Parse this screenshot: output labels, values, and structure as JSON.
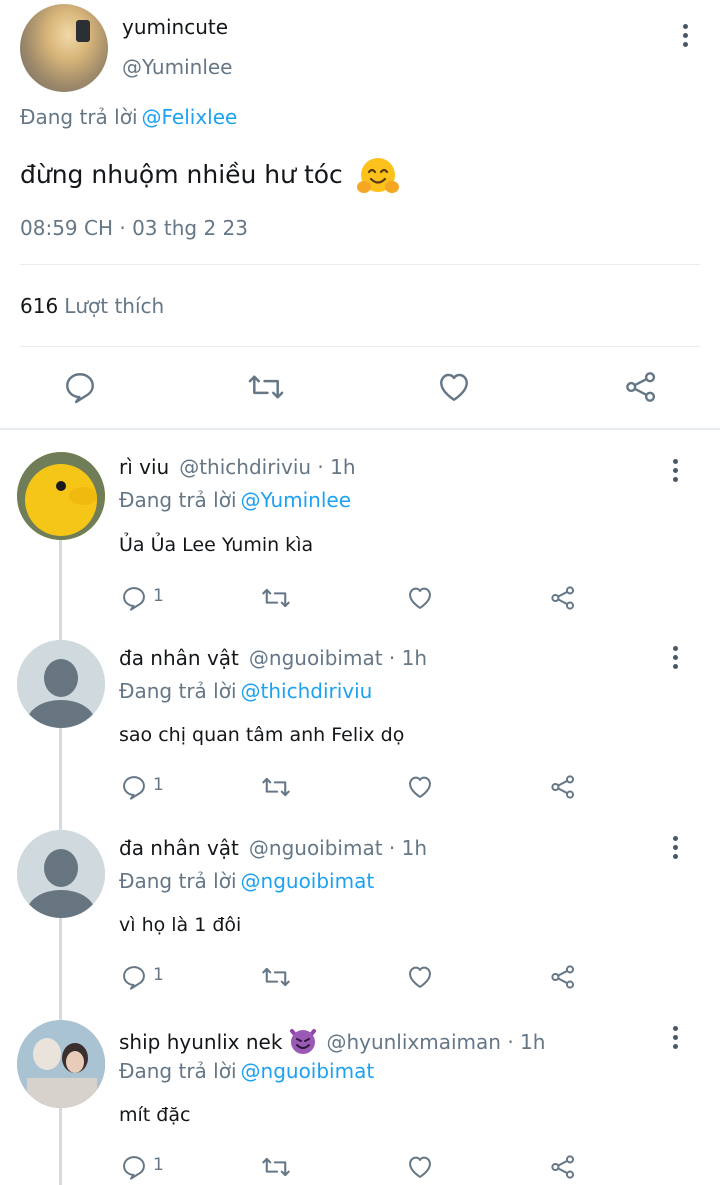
{
  "tweet": {
    "author_name": "yumincute",
    "author_handle": "@Yuminlee",
    "reply_prefix": "Đang trả lời",
    "reply_to": "@Felixlee",
    "text": "đừng nhuộm nhiều hư tóc",
    "emoji_icon": "hugging-face-icon",
    "timestamp": "08:59 CH · 03 thg 2 23",
    "like_count": "616",
    "like_label": "Lượt thích",
    "actions": [
      "reply-icon",
      "retweet-icon",
      "like-icon",
      "share-icon"
    ]
  },
  "replies": [
    {
      "name": "rì viu",
      "handle": "@thichdiriviu · 1h",
      "reply_prefix": "Đang trả lời",
      "reply_to": "@Yuminlee",
      "text": "Ủa Ủa Lee Yumin kìa",
      "reply_count": "1"
    },
    {
      "name": "đa nhân vật",
      "handle": "@nguoibimat · 1h",
      "reply_prefix": "Đang trả lời",
      "reply_to": "@thichdiriviu",
      "text": "sao chị quan tâm anh Felix dọ",
      "reply_count": "1"
    },
    {
      "name": "đa nhân vật",
      "handle": "@nguoibimat · 1h",
      "reply_prefix": "Đang trả lời",
      "reply_to": "@nguoibimat",
      "text": "vì họ là 1 đôi",
      "reply_count": "1"
    },
    {
      "name": "ship hyunlix nek",
      "name_emoji_icon": "smiling-devil-icon",
      "handle": "@hyunlixmaiman · 1h",
      "reply_prefix": "Đang trả lời",
      "reply_to": "@nguoibimat",
      "text": "mít đặc",
      "reply_count": "1"
    }
  ],
  "colors": {
    "accent": "#1da1f2",
    "muted": "#657786",
    "icon": "#657786",
    "separator": "#e6ecf0"
  }
}
